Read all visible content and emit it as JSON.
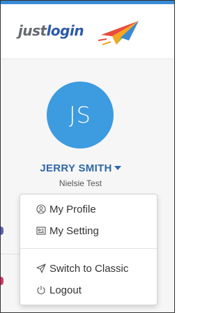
{
  "brand": {
    "logo_part1": "just",
    "logo_part2": "login"
  },
  "colors": {
    "accent": "#3a8ad6",
    "avatar": "#3d9be0",
    "name": "#2e67a8"
  },
  "profile": {
    "initials": "JS",
    "name": "JERRY SMITH",
    "company": "Nielsie Test"
  },
  "menu": {
    "my_profile": "My Profile",
    "my_setting": "My Setting",
    "switch_classic": "Switch to Classic",
    "logout": "Logout"
  },
  "icons": [
    "user-circle-icon",
    "settings-card-icon",
    "paper-plane-icon",
    "power-icon",
    "chevron-down-icon"
  ]
}
